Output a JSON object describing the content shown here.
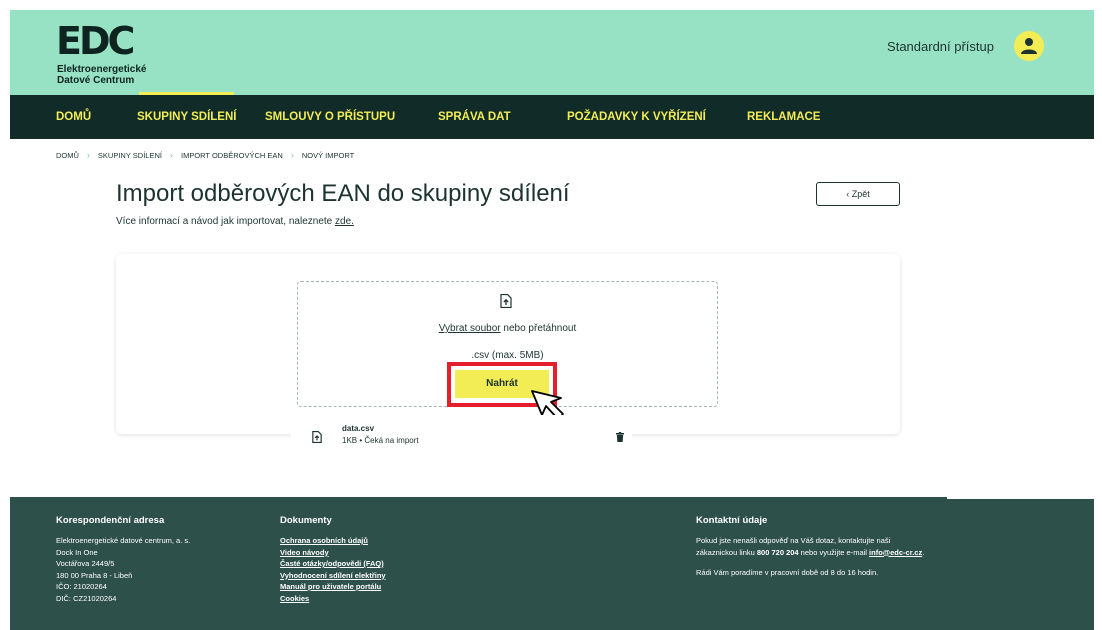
{
  "brand": {
    "mark": "EDC",
    "line1": "Elektroenergetické",
    "line2": "Datové Centrum"
  },
  "header": {
    "access_label": "Standardní přístup",
    "avatar_icon": "user-icon"
  },
  "nav": {
    "items": [
      {
        "label": "DOMŮ"
      },
      {
        "label": "SKUPINY SDÍLENÍ",
        "active": true
      },
      {
        "label": "SMLOUVY O PŘÍSTUPU"
      },
      {
        "label": "SPRÁVA DAT"
      },
      {
        "label": "POŽADAVKY K VYŘÍZENÍ"
      },
      {
        "label": "REKLAMACE"
      }
    ]
  },
  "breadcrumb": [
    "DOMŮ",
    "SKUPINY SDÍLENÍ",
    "IMPORT ODBĚROVÝCH EAN",
    "NOVÝ IMPORT"
  ],
  "page": {
    "title": "Import odběrových EAN do skupiny sdílení",
    "subtitle": "Více informací a návod jak importovat, naleznete",
    "subtitle_link": "zde.",
    "back_label": "‹  Zpět"
  },
  "upload": {
    "select_link": "Vybrat soubor",
    "select_rest": " nebo přetáhnout",
    "format": ".csv (max. 5MB)",
    "upload_button": "Nahrát"
  },
  "file": {
    "name": "data.csv",
    "meta": "1KB • Čeká na import"
  },
  "footer": {
    "address": {
      "heading": "Korespondenční adresa",
      "lines": [
        "Elektroenergetické datové centrum, a. s.",
        "Dock In One",
        "Voctářova 2449/5",
        "180 00 Praha 8 - Libeň",
        "IČO: 21020264",
        "DIČ: CZ21020264"
      ]
    },
    "documents": {
      "heading": "Dokumenty",
      "links": [
        "Ochrana osobních údajů",
        "Video návody",
        "Časté otázky/odpovědi (FAQ)",
        "Vyhodnocení sdílení elektřiny",
        "Manuál pro uživatele portálu",
        "Cookies"
      ]
    },
    "contact": {
      "heading": "Kontaktní údaje",
      "p1_line1": "Pokud jste nenašli odpověď na Váš dotaz, kontaktujte naši",
      "p1_pre": "zákaznickou linku ",
      "phone": "800 720 204",
      "p1_mid": " nebo využijte e-mail ",
      "email": "info@edc-cr.cz",
      "p1_end": ".",
      "p2": "Rádi Vám poradíme v pracovní době od 8 do 16 hodin."
    }
  },
  "colors": {
    "header_bg": "#97e2c5",
    "nav_bg": "#102b28",
    "accent_yellow": "#f2ec55",
    "footer_bg": "#2d504a",
    "highlight_red": "#e41e2a"
  }
}
